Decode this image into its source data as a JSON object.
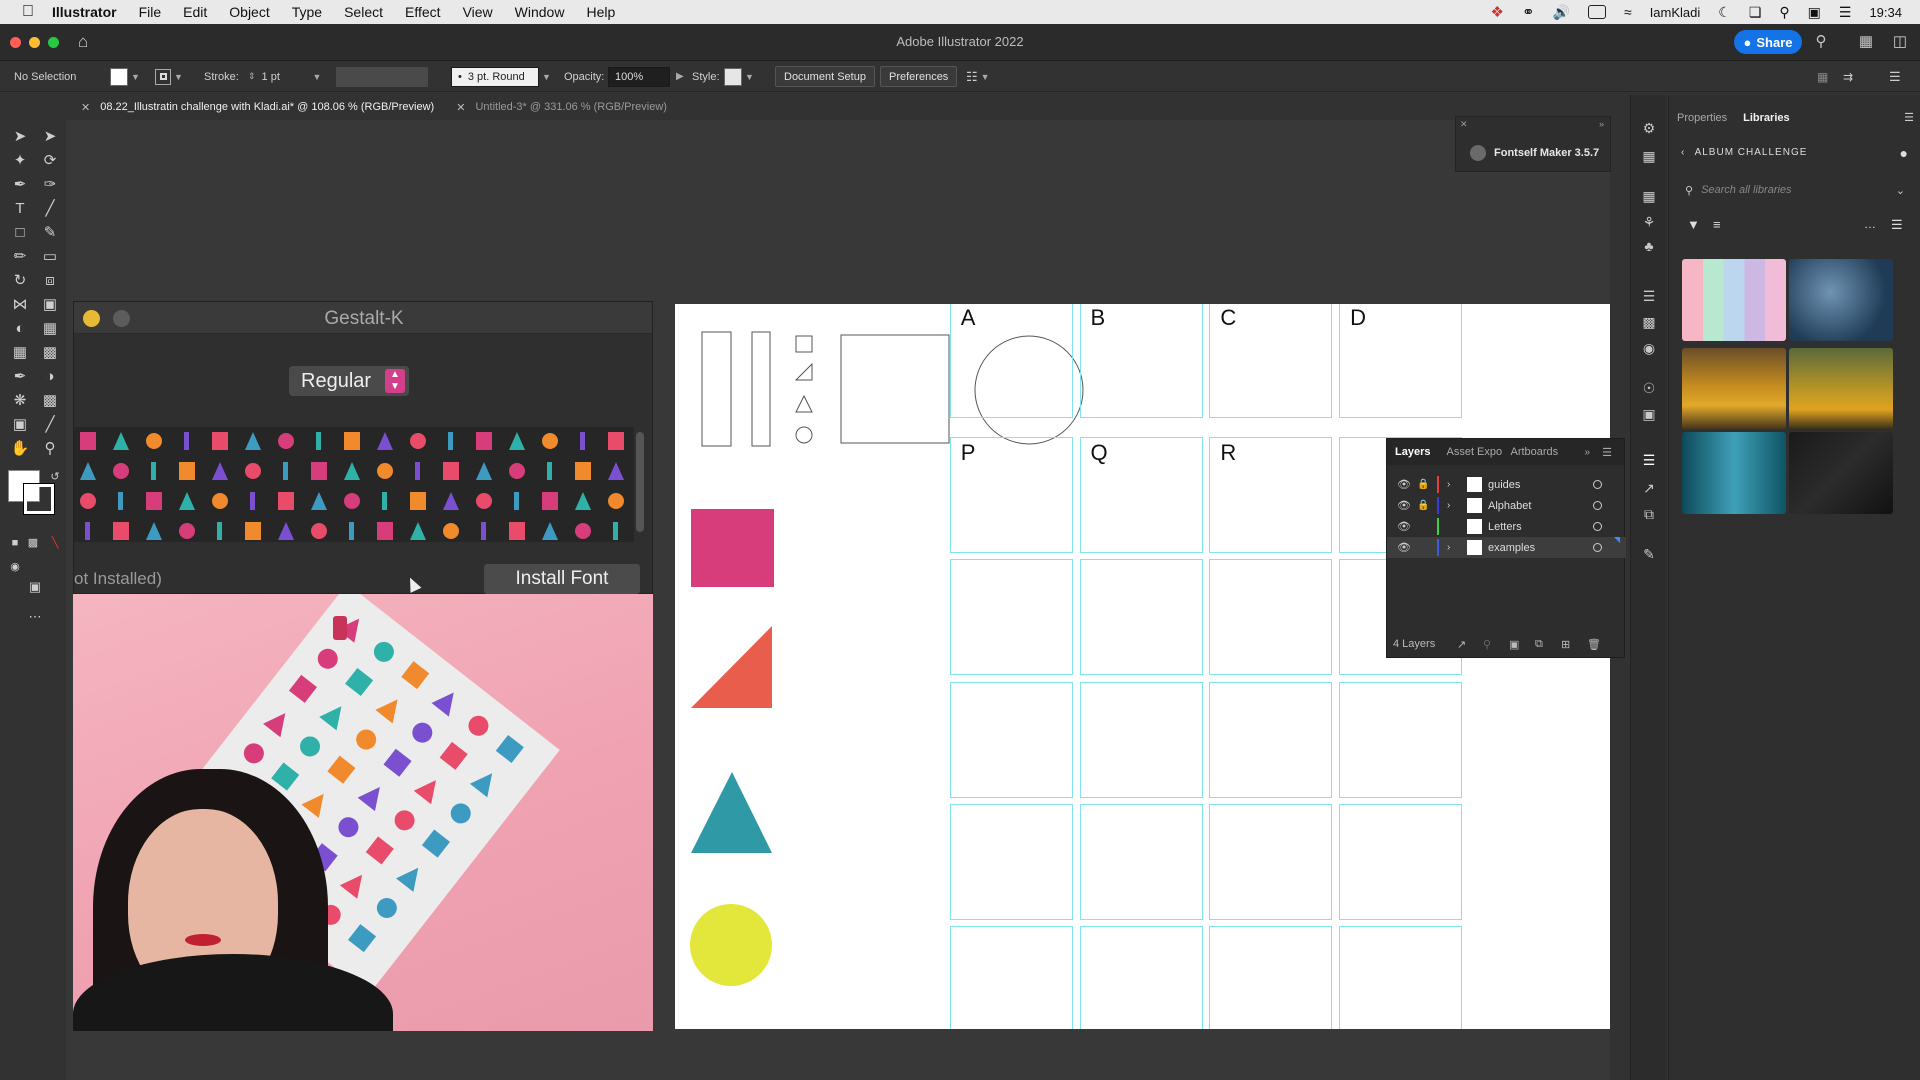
{
  "menubar": {
    "apple": "",
    "items": [
      "Illustrator",
      "File",
      "Edit",
      "Object",
      "Type",
      "Select",
      "Effect",
      "View",
      "Window",
      "Help"
    ],
    "user": "IamKladi",
    "clock": "19:34"
  },
  "appbar": {
    "title": "Adobe Illustrator 2022",
    "share_label": "Share"
  },
  "control": {
    "selection": "No Selection",
    "stroke_label": "Stroke:",
    "stroke_value": "1 pt",
    "brush_value": "3 pt. Round",
    "opacity_label": "Opacity:",
    "opacity_value": "100%",
    "style_label": "Style:",
    "document_setup": "Document Setup",
    "preferences": "Preferences"
  },
  "tabs": [
    {
      "label": "08.22_Illustratin challenge with Kladi.ai* @ 108.06 % (RGB/Preview)",
      "active": true
    },
    {
      "label": "Untitled-3* @ 331.06 % (RGB/Preview)",
      "active": false
    }
  ],
  "gestalt": {
    "title": "Gestalt-K",
    "style": "Regular",
    "status": "ot Installed)",
    "install_label": "Install Font"
  },
  "fontself": {
    "title": "Fontself Maker 3.5.7"
  },
  "grid_letters": [
    "A",
    "B",
    "C",
    "D",
    "P",
    "Q",
    "R"
  ],
  "layers": {
    "tabs": [
      "Layers",
      "Asset Expo",
      "Artboards"
    ],
    "rows": [
      {
        "name": "guides",
        "color": "#e0413b"
      },
      {
        "name": "Alphabet",
        "color": "#3b3ae0"
      },
      {
        "name": "Letters",
        "color": "#3bd046"
      },
      {
        "name": "examples",
        "color": "#3b5be0"
      }
    ],
    "count": "4 Layers"
  },
  "libraries": {
    "tabs": [
      "Properties",
      "Libraries"
    ],
    "breadcrumb": "ALBUM CHALLENGE",
    "search_placeholder": "Search all libraries"
  },
  "colors": {
    "pink": "#d73d7a",
    "coral": "#e85d4c",
    "teal": "#2f9aa6",
    "yellow": "#e3e63b",
    "guide": "#7fe4ec",
    "accent": "#1473e6"
  }
}
